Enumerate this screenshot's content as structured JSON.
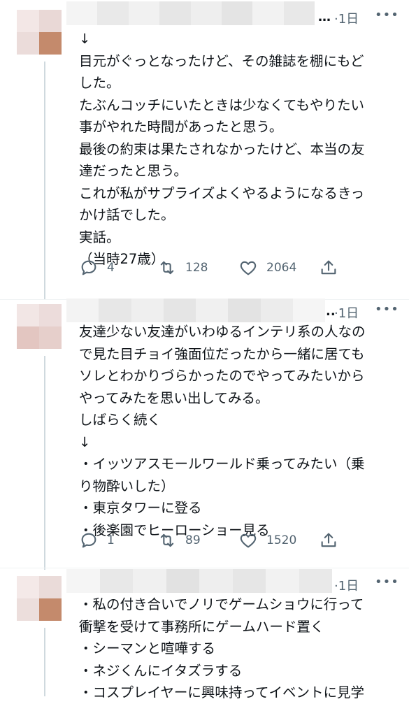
{
  "tweets": [
    {
      "ellipsis": "…",
      "time": "·1日",
      "lines": [
        "↓",
        "目元がぐっとなったけど、その雑誌を棚にもど",
        "した。",
        "たぶんコッチにいたときは少なくてもやりたい",
        "事がやれた時間があったと思う。",
        "最後の約束は果たされなかったけど、本当の友",
        "達だったと思う。",
        "これが私がサプライズよくやるようになるきっ",
        "かけ話でした。",
        "実話。",
        "（当時27歳）"
      ],
      "replies": "4",
      "retweets": "128",
      "likes": "2064"
    },
    {
      "ellipsis": "..",
      "time": "·1日",
      "lines": [
        "友達少ない友達がいわゆるインテリ系の人なの",
        "で見た目チョイ強面位だったから一緒に居ても",
        "ソレとわかりづらかったのでやってみたいから",
        "やってみたを思い出してみる。",
        "しばらく続く",
        "↓",
        "・イッツアスモールワールド乗ってみたい（乗",
        "り物酔いした）",
        "・東京タワーに登る",
        "・後楽園でヒーローショー見る"
      ],
      "replies": "1",
      "retweets": "89",
      "likes": "1520"
    },
    {
      "ellipsis": "",
      "time": "·1日",
      "lines": [
        "・私の付き合いでノリでゲームショウに行って",
        "衝撃を受けて事務所にゲームハード置く",
        "・シーマンと喧嘩する",
        "・ネジくんにイタズラする",
        "・コスプレイヤーに興味持ってイベントに見学"
      ]
    }
  ],
  "icons": {
    "more": "more-icon",
    "reply": "reply-icon",
    "retweet": "retweet-icon",
    "like": "heart-icon",
    "share": "share-icon"
  },
  "colors": {
    "text": "#0f1419",
    "secondary": "#536471",
    "thread_line": "#cfd9de"
  }
}
